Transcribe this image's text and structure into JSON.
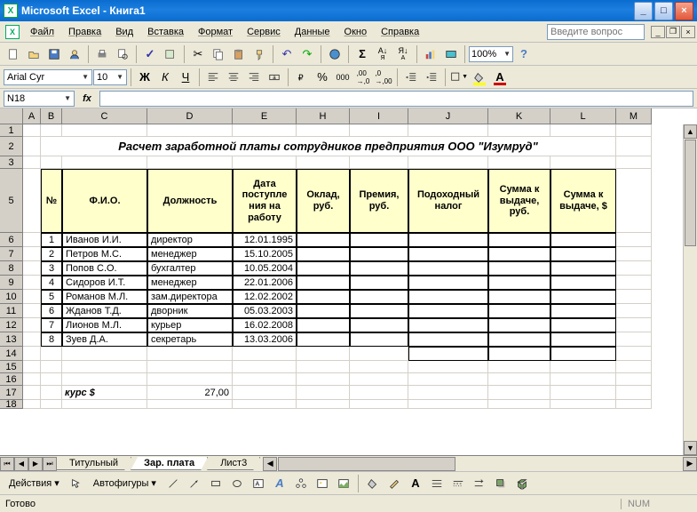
{
  "title": "Microsoft Excel - Книга1",
  "menu": [
    "Файл",
    "Правка",
    "Вид",
    "Вставка",
    "Формат",
    "Сервис",
    "Данные",
    "Окно",
    "Справка"
  ],
  "help_placeholder": "Введите вопрос",
  "zoom": "100%",
  "font": {
    "name": "Arial Cyr",
    "size": "10"
  },
  "namebox": "N18",
  "columns": [
    {
      "l": "A",
      "w": 20
    },
    {
      "l": "B",
      "w": 24
    },
    {
      "l": "C",
      "w": 96
    },
    {
      "l": "D",
      "w": 96
    },
    {
      "l": "E",
      "w": 72
    },
    {
      "l": "H",
      "w": 60
    },
    {
      "l": "I",
      "w": 66
    },
    {
      "l": "J",
      "w": 90
    },
    {
      "l": "K",
      "w": 70
    },
    {
      "l": "L",
      "w": 74
    },
    {
      "l": "M",
      "w": 40
    }
  ],
  "rows": [
    {
      "n": 1,
      "h": 14
    },
    {
      "n": 2,
      "h": 22
    },
    {
      "n": 3,
      "h": 14
    },
    {
      "n": 5,
      "h": 72
    },
    {
      "n": 6,
      "h": 16
    },
    {
      "n": 7,
      "h": 16
    },
    {
      "n": 8,
      "h": 16
    },
    {
      "n": 9,
      "h": 16
    },
    {
      "n": 10,
      "h": 16
    },
    {
      "n": 11,
      "h": 16
    },
    {
      "n": 12,
      "h": 16
    },
    {
      "n": 13,
      "h": 16
    },
    {
      "n": 14,
      "h": 16
    },
    {
      "n": 15,
      "h": 14
    },
    {
      "n": 16,
      "h": 14
    },
    {
      "n": 17,
      "h": 16
    },
    {
      "n": 18,
      "h": 10
    }
  ],
  "doc_title": "Расчет заработной платы сотрудников предприятия ООО \"Изумруд\"",
  "headers": [
    "№",
    "Ф.И.О.",
    "Должность",
    "Дата поступле\nния на работу",
    "Оклад, руб.",
    "Премия, руб.",
    "Подоходный налог",
    "Сумма к выдаче, руб.",
    "Сумма к выдаче, $"
  ],
  "data": [
    {
      "n": "1",
      "fio": "Иванов И.И.",
      "pos": "директор",
      "date": "12.01.1995"
    },
    {
      "n": "2",
      "fio": "Петров М.С.",
      "pos": "менеджер",
      "date": "15.10.2005"
    },
    {
      "n": "3",
      "fio": "Попов С.О.",
      "pos": "бухгалтер",
      "date": "10.05.2004"
    },
    {
      "n": "4",
      "fio": "Сидоров И.Т.",
      "pos": "менеджер",
      "date": "22.01.2006"
    },
    {
      "n": "5",
      "fio": "Романов М.Л.",
      "pos": "зам.директора",
      "date": "12.02.2002"
    },
    {
      "n": "6",
      "fio": "Жданов Т.Д.",
      "pos": "дворник",
      "date": "05.03.2003"
    },
    {
      "n": "7",
      "fio": "Лионов М.Л.",
      "pos": "курьер",
      "date": "16.02.2008"
    },
    {
      "n": "8",
      "fio": "Зуев Д.А.",
      "pos": "секретарь",
      "date": "13.03.2006"
    }
  ],
  "kurs_label": "курс $",
  "kurs_value": "27,00",
  "tabs": [
    "Титульный",
    "Зар. плата",
    "Лист3"
  ],
  "active_tab": 1,
  "draw": {
    "action": "Действия",
    "autoshapes": "Автофигуры"
  },
  "status": {
    "ready": "Готово",
    "num": "NUM"
  }
}
